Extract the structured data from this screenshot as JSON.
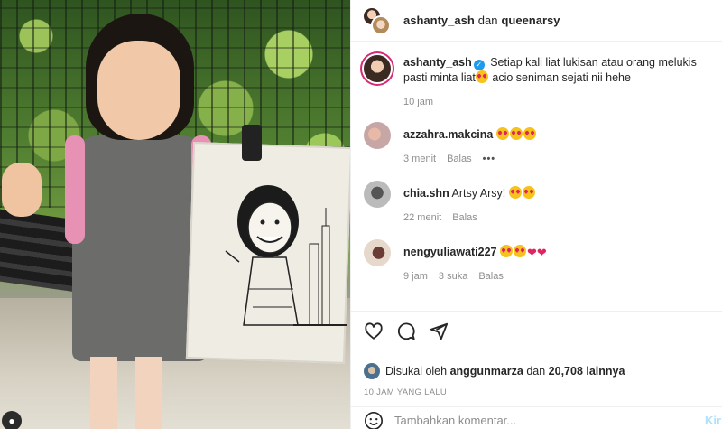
{
  "header": {
    "user1": "ashanty_ash",
    "connector": "dan",
    "user2": "queenarsy"
  },
  "caption": {
    "username": "ashanty_ash",
    "text_part1": "Setiap kali liat lukisan atau orang melukis pasti minta liat",
    "text_part2": "acio seniman sejati nii hehe",
    "time": "10 jam"
  },
  "comments": [
    {
      "username": "azzahra.makcina",
      "text": "",
      "time": "3 menit",
      "reply": "Balas"
    },
    {
      "username": "chia.shn",
      "text": "Artsy Arsy!",
      "time": "22 menit",
      "reply": "Balas"
    },
    {
      "username": "nengyuliawati227",
      "text": "",
      "time": "9 jam",
      "likes": "3 suka",
      "reply": "Balas"
    }
  ],
  "likes": {
    "prefix": "Disukai oleh",
    "user": "anggunmarza",
    "connector": "dan",
    "count_text": "20,708 lainnya"
  },
  "time_ago": "10 JAM YANG LALU",
  "add_comment": {
    "placeholder": "Tambahkan komentar...",
    "post_label": "Kirim"
  },
  "colors": {
    "verified": "#1d9bf0",
    "heart": "#e0245e",
    "muted": "#8e8e8e"
  }
}
